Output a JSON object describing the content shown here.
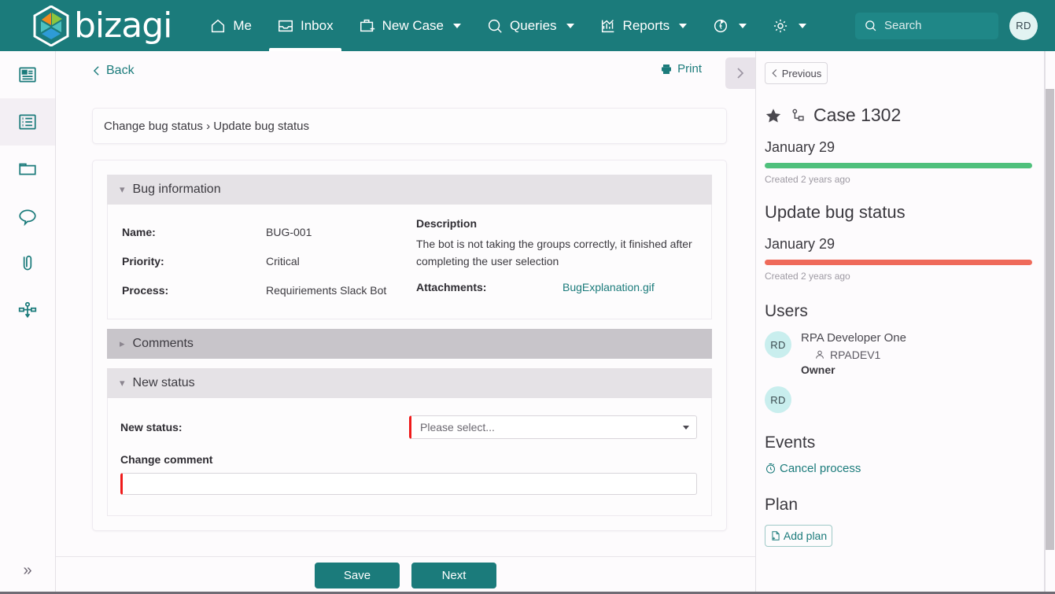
{
  "header": {
    "brand": "bizagi",
    "logo_icon": "bizagi-hexagon-logo",
    "nav": [
      {
        "label": "Me",
        "icon": "home-icon",
        "caret": false,
        "active": false
      },
      {
        "label": "Inbox",
        "icon": "inbox-icon",
        "caret": false,
        "active": true
      },
      {
        "label": "New Case",
        "icon": "briefcase-plus-icon",
        "caret": true,
        "active": false
      },
      {
        "label": "Queries",
        "icon": "search-icon",
        "caret": true,
        "active": false
      },
      {
        "label": "Reports",
        "icon": "chart-icon",
        "caret": true,
        "active": false
      },
      {
        "label": "",
        "icon": "refresh-icon",
        "caret": true,
        "active": false
      },
      {
        "label": "",
        "icon": "gear-icon",
        "caret": true,
        "active": false
      }
    ],
    "search": {
      "placeholder": "Search",
      "value": "",
      "icon": "search-icon"
    },
    "avatar": "RD"
  },
  "rail": {
    "items": [
      {
        "icon": "summary-card-icon",
        "selected": false
      },
      {
        "icon": "list-icon",
        "selected": true
      },
      {
        "icon": "folder-icon",
        "selected": false
      },
      {
        "icon": "comment-icon",
        "selected": false
      },
      {
        "icon": "paperclip-icon",
        "selected": false
      },
      {
        "icon": "process-diagram-icon",
        "selected": false
      }
    ],
    "expand_label": "»"
  },
  "main": {
    "back_label": "Back",
    "print_label": "Print",
    "panel_toggle_icon": "chevron-right-icon",
    "breadcrumb": "Change bug status › Update bug status",
    "sections": [
      {
        "key": "bug_information",
        "title": "Bug information",
        "expanded": true,
        "fields": [
          {
            "label": "Name:",
            "value": "BUG-001"
          },
          {
            "label": "Priority:",
            "value": "Critical"
          },
          {
            "label": "Process:",
            "value": "Requiriements Slack Bot"
          }
        ],
        "description_title": "Description",
        "description_text": "The bot is not taking the groups correctly, it finished after completing the user selection",
        "attachments_label": "Attachments:",
        "attachment_name": "BugExplanation.gif"
      },
      {
        "key": "comments",
        "title": "Comments",
        "expanded": false
      },
      {
        "key": "new_status",
        "title": "New status",
        "expanded": true,
        "status_label": "New status:",
        "status_placeholder": "Please select...",
        "status_value": "",
        "comment_label": "Change comment",
        "comment_value": ""
      }
    ]
  },
  "right_panel": {
    "previous_label": "Previous",
    "case_title": "Case 1302",
    "star_icon": "star-filled-icon",
    "process_icon": "process-node-icon",
    "stages": [
      {
        "date": "January 29",
        "color": "#4fc07c",
        "meta": "Created 2 years ago",
        "name": ""
      },
      {
        "name": "Update bug status",
        "date": "January 29",
        "color": "#ef6a5a",
        "meta": "Created 2 years ago"
      }
    ],
    "users_title": "Users",
    "users": [
      {
        "initials": "RD",
        "name": "RPA Developer One",
        "username": "RPADEV1",
        "role": "Owner",
        "user_icon": "person-icon"
      },
      {
        "initials": "RD",
        "name": "",
        "username": "",
        "role": ""
      }
    ],
    "events_title": "Events",
    "events": [
      {
        "label": "Cancel process",
        "icon": "timer-icon"
      }
    ],
    "plan_title": "Plan",
    "plan_button": {
      "label": "Add plan",
      "icon": "file-plus-icon"
    }
  },
  "footer": {
    "save_label": "Save",
    "next_label": "Next"
  },
  "colors": {
    "brand_teal": "#1b7b7b",
    "stage_green": "#4fc07c",
    "stage_red": "#ef6a5a",
    "required_red": "#ef1b1b",
    "avatar_bg": "#c9eeee"
  }
}
